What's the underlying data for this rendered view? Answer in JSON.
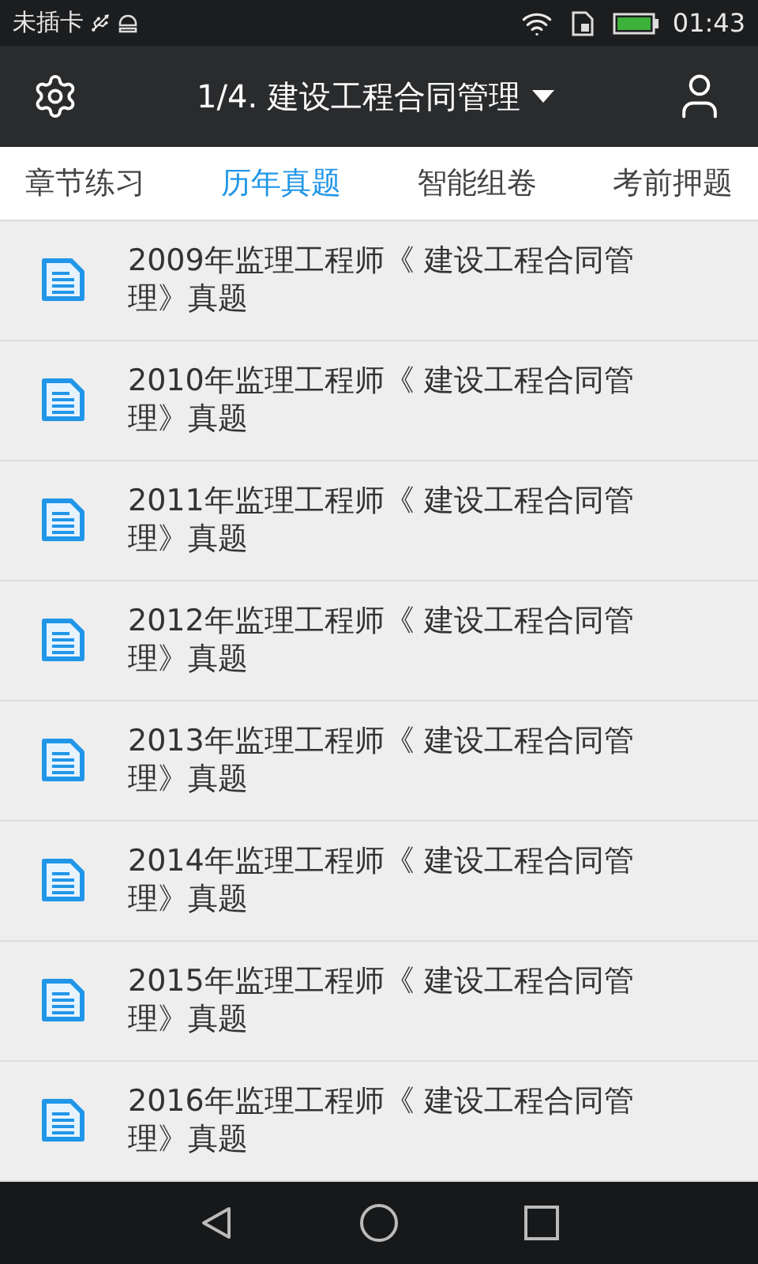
{
  "status_bar": {
    "carrier": "未插卡",
    "time": "01:43"
  },
  "app_bar": {
    "title": "1/4. 建设工程合同管理"
  },
  "tabs": [
    {
      "label": "章节练习",
      "selected": false
    },
    {
      "label": "历年真题",
      "selected": true
    },
    {
      "label": "智能组卷",
      "selected": false
    },
    {
      "label": "考前押题",
      "selected": false
    }
  ],
  "items": [
    {
      "title": "2009年监理工程师《 建设工程合同管理》真题"
    },
    {
      "title": "2010年监理工程师《 建设工程合同管理》真题"
    },
    {
      "title": "2011年监理工程师《 建设工程合同管理》真题"
    },
    {
      "title": "2012年监理工程师《 建设工程合同管理》真题"
    },
    {
      "title": "2013年监理工程师《 建设工程合同管理》真题"
    },
    {
      "title": "2014年监理工程师《 建设工程合同管理》真题"
    },
    {
      "title": "2015年监理工程师《 建设工程合同管理》真题"
    },
    {
      "title": "2016年监理工程师《 建设工程合同管理》真题"
    }
  ]
}
